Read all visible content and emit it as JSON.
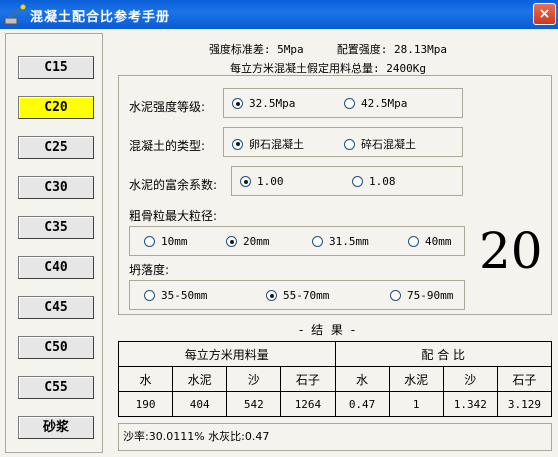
{
  "window": {
    "title": "混凝土配合比参考手册",
    "close_label": "×"
  },
  "grades": [
    "C15",
    "C20",
    "C25",
    "C30",
    "C35",
    "C40",
    "C45",
    "C50",
    "C55",
    "砂浆"
  ],
  "selected_grade": "C20",
  "header": {
    "std_dev": "强度标准差: 5Mpa",
    "prep_strength": "配置强度: 28.13Mpa",
    "assumed_mass": "每立方米混凝土假定用料总量: 2400Kg"
  },
  "params": {
    "cement_grade": {
      "label": "水泥强度等级:",
      "options": [
        "32.5Mpa",
        "42.5Mpa"
      ],
      "selected": 0
    },
    "concrete_type": {
      "label": "混凝土的类型:",
      "options": [
        "卵石混凝土",
        "碎石混凝土"
      ],
      "selected": 0
    },
    "cement_surplus": {
      "label": "水泥的富余系数:",
      "options": [
        "1.00",
        "1.08"
      ],
      "selected": 0
    },
    "aggregate_size": {
      "label": "粗骨粒最大粒径:",
      "options": [
        "10mm",
        "20mm",
        "31.5mm",
        "40mm"
      ],
      "selected": 1
    },
    "slump": {
      "label": "坍落度:",
      "options": [
        "35-50mm",
        "55-70mm",
        "75-90mm"
      ],
      "selected": 1
    }
  },
  "display_value": "20",
  "results": {
    "title": "- 结 果 -",
    "group_amount": "每立方米用料量",
    "group_ratio": "配 合 比",
    "columns": [
      "水",
      "水泥",
      "沙",
      "石子",
      "水",
      "水泥",
      "沙",
      "石子"
    ],
    "values": [
      "190",
      "404",
      "542",
      "1264",
      "0.47",
      "1",
      "1.342",
      "3.129"
    ]
  },
  "summary": "沙率:30.0111% 水灰比:0.47"
}
